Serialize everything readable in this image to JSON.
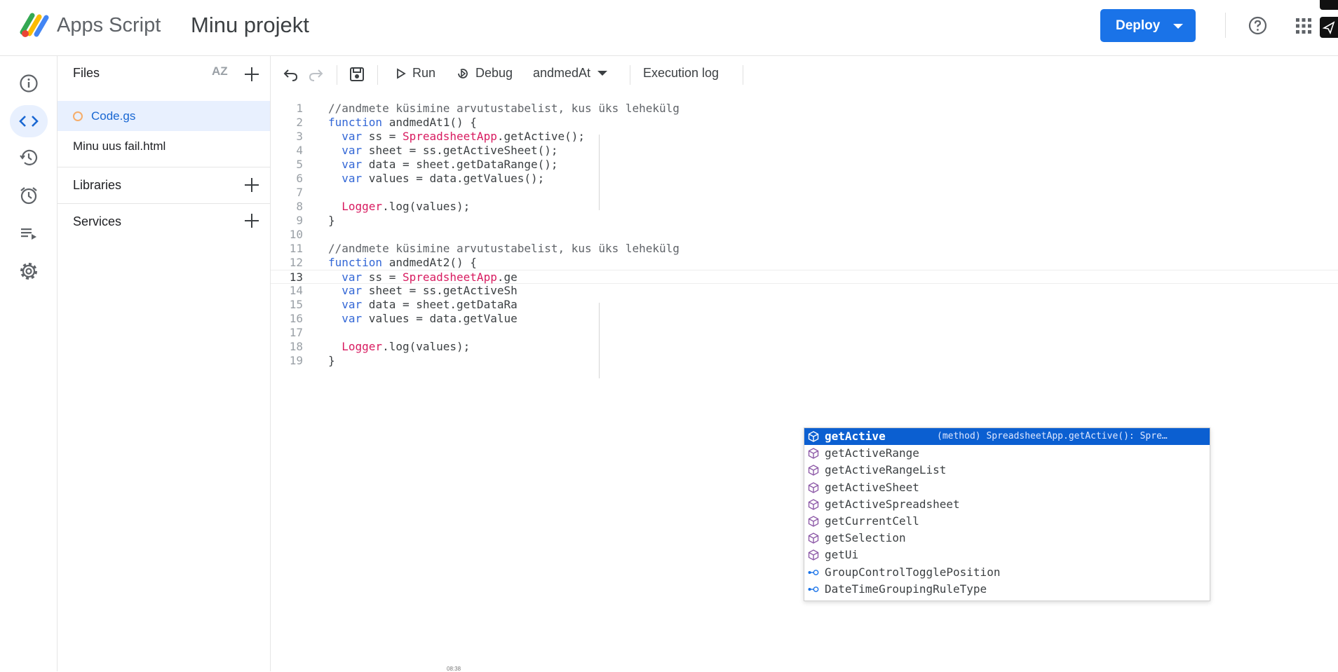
{
  "header": {
    "app_name": "Apps Script",
    "project_name": "Minu projekt",
    "deploy_label": "Deploy",
    "icons": [
      "apps-script-logo-icon",
      "help-icon",
      "google-apps-icon"
    ]
  },
  "nav_rail": {
    "items": [
      {
        "name": "overview-icon",
        "active": false
      },
      {
        "name": "editor-icon",
        "active": true
      },
      {
        "name": "history-icon",
        "active": false
      },
      {
        "name": "triggers-icon",
        "active": false
      },
      {
        "name": "executions-icon",
        "active": false
      },
      {
        "name": "settings-icon",
        "active": false
      }
    ]
  },
  "files_panel": {
    "title": "Files",
    "sort_icon": "AZ",
    "files": [
      {
        "label": "Code.gs",
        "active": true
      },
      {
        "label": "Minu uus fail.html",
        "active": false
      }
    ],
    "libraries_label": "Libraries",
    "services_label": "Services"
  },
  "toolbar": {
    "run_label": "Run",
    "debug_label": "Debug",
    "function_select": "andmedAt",
    "execution_log_label": "Execution log"
  },
  "editor": {
    "current_line": 13,
    "lines": [
      {
        "n": "1",
        "text": "//andmete küsimine arvutustabelist, kus üks lehekülg"
      },
      {
        "n": "2",
        "text": "function andmedAt1() {"
      },
      {
        "n": "3",
        "text": "  var ss = SpreadsheetApp.getActive();"
      },
      {
        "n": "4",
        "text": "  var sheet = ss.getActiveSheet();"
      },
      {
        "n": "5",
        "text": "  var data = sheet.getDataRange();"
      },
      {
        "n": "6",
        "text": "  var values = data.getValues();"
      },
      {
        "n": "7",
        "text": ""
      },
      {
        "n": "8",
        "text": "  Logger.log(values);"
      },
      {
        "n": "9",
        "text": "}"
      },
      {
        "n": "10",
        "text": ""
      },
      {
        "n": "11",
        "text": "//andmete küsimine arvutustabelist, kus üks lehekülg"
      },
      {
        "n": "12",
        "text": "function andmedAt2() {"
      },
      {
        "n": "13",
        "text": "  var ss = SpreadsheetApp.ge"
      },
      {
        "n": "14",
        "text": "  var sheet = ss.getActiveSh"
      },
      {
        "n": "15",
        "text": "  var data = sheet.getDataRa"
      },
      {
        "n": "16",
        "text": "  var values = data.getValue"
      },
      {
        "n": "17",
        "text": ""
      },
      {
        "n": "18",
        "text": "  Logger.log(values);"
      },
      {
        "n": "19",
        "text": "}"
      }
    ]
  },
  "suggestions": {
    "items": [
      {
        "label": "getActive",
        "kind": "method",
        "detail": "(method) SpreadsheetApp.getActive(): Spre…",
        "selected": true
      },
      {
        "label": "getActiveRange",
        "kind": "method",
        "detail": "",
        "selected": false
      },
      {
        "label": "getActiveRangeList",
        "kind": "method",
        "detail": "",
        "selected": false
      },
      {
        "label": "getActiveSheet",
        "kind": "method",
        "detail": "",
        "selected": false
      },
      {
        "label": "getActiveSpreadsheet",
        "kind": "method",
        "detail": "",
        "selected": false
      },
      {
        "label": "getCurrentCell",
        "kind": "method",
        "detail": "",
        "selected": false
      },
      {
        "label": "getSelection",
        "kind": "method",
        "detail": "",
        "selected": false
      },
      {
        "label": "getUi",
        "kind": "method",
        "detail": "",
        "selected": false
      },
      {
        "label": "GroupControlTogglePosition",
        "kind": "enum",
        "detail": "",
        "selected": false
      },
      {
        "label": "DateTimeGroupingRuleType",
        "kind": "enum",
        "detail": "",
        "selected": false
      }
    ]
  },
  "footer": {
    "timestamp": "08:38"
  },
  "colors": {
    "accent": "#1a73e8",
    "selected_suggestion": "#0b5fd1",
    "active_nav": "#e8f0fe",
    "comment": "#5f6368",
    "keyword": "#3367d6",
    "class_name": "#d81b60"
  }
}
